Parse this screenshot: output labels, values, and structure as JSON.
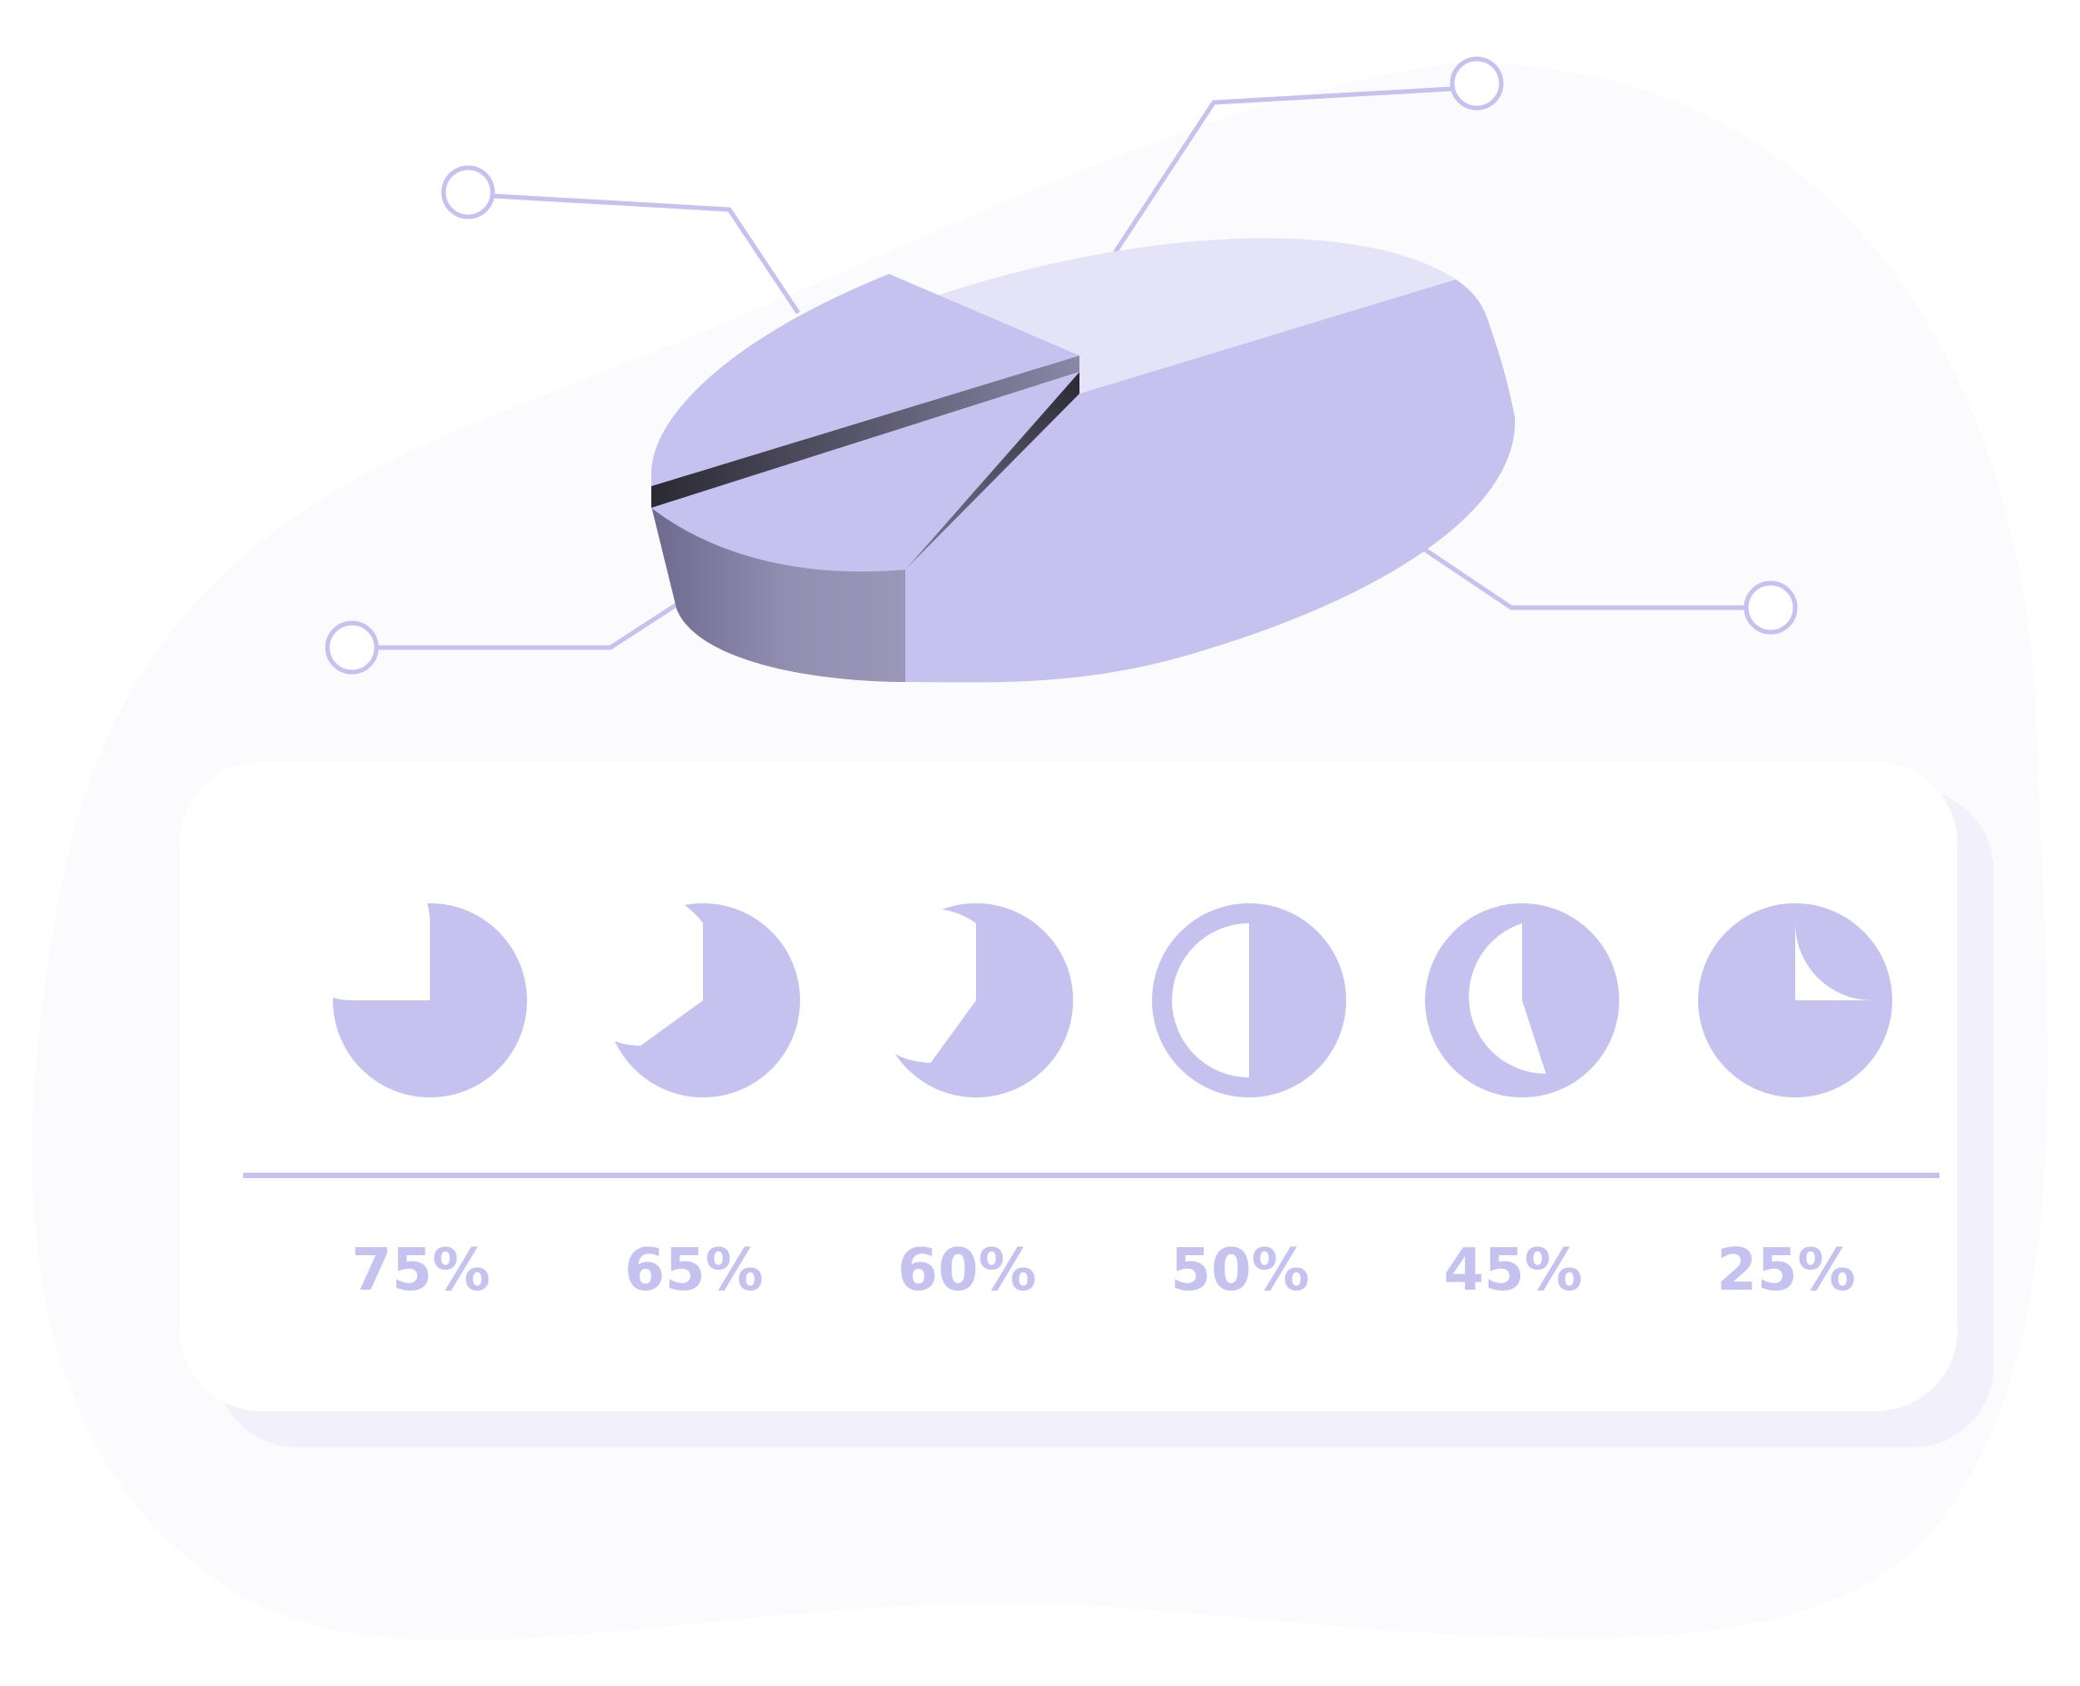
{
  "colors": {
    "accent": "#c5c2f0",
    "accent_light": "#e5e3f8",
    "accent_dark": "#9895b5",
    "blob": "#fbfbfe",
    "card": "#ffffff",
    "card_shadow": "#f2f1fb",
    "connector": "#c5c2f0"
  },
  "icons": [
    "pie-chart-3d",
    "callout-node-icon"
  ],
  "chart_data": [
    {
      "type": "pie",
      "style": "3d",
      "slices": 4,
      "values": [],
      "labels": []
    },
    {
      "type": "pie",
      "style": "progress-dials",
      "categories": [
        "75%",
        "65%",
        "60%",
        "50%",
        "45%",
        "25%"
      ],
      "values": [
        75,
        65,
        60,
        50,
        45,
        25
      ]
    }
  ]
}
